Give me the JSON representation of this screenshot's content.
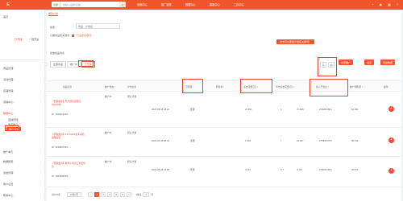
{
  "topbar": {
    "logo": "E",
    "search_select": "全部",
    "search_placeholder": "请输入品牌/店铺",
    "search_btn": "Q",
    "tabs": [
      "营销中心",
      "推广服务",
      "数据中心",
      "客服中心",
      "工具中心"
    ],
    "icons": [
      "bell-icon",
      "user-icon",
      "grid-icon",
      "help-icon"
    ]
  },
  "sidebar": {
    "items": [
      {
        "label": "首页",
        "name": "sidebar-item-home"
      },
      {
        "label": "商品管理",
        "name": "sidebar-item-goods"
      },
      {
        "label": "活动管理",
        "name": "sidebar-item-activity"
      },
      {
        "label": "店铺管理",
        "name": "sidebar-item-shop"
      },
      {
        "label": "营销中心",
        "name": "sidebar-item-marketing"
      },
      {
        "label": "数据中心",
        "name": "sidebar-item-data"
      },
      {
        "label": "直播管理",
        "name": "sidebar-item-live"
      },
      {
        "label": "商品推广",
        "name": "sidebar-item-goods-promo"
      },
      {
        "label": "推广计划",
        "name": "sidebar-item-plan"
      },
      {
        "label": "推广单元",
        "name": "sidebar-item-unit"
      },
      {
        "label": "数据报表",
        "name": "sidebar-item-report"
      },
      {
        "label": "资金管理",
        "name": "sidebar-item-finance"
      },
      {
        "label": "账户设置",
        "name": "sidebar-item-account"
      },
      {
        "label": "帮助中心",
        "name": "sidebar-item-help"
      }
    ],
    "badge_left": "已开通",
    "badge_right": "一键开启"
  },
  "main": {
    "breadcrumb": "爆款计划",
    "filter_label": "搜索：",
    "filter_value": "商品、计划名",
    "check_label": "只看未设置关键词",
    "check_label2": "已设置关键词",
    "tabs": [
      "全部商品",
      "推广中",
      "已暂停"
    ],
    "list_label": "投放商品列表",
    "callout": "点击可以添加计划名关键词！",
    "btn_add": "新增推广",
    "btn_batch": "批量",
    "btn_export": "导出数据"
  },
  "table": {
    "headers": [
      "商品信息",
      "推广状态",
      "计划信息",
      "日预算 ↕",
      "转化率 ↕",
      "点击花费(元) ↕",
      "平均点击花费(元) ↕",
      "投入产出比 ↕",
      "推广销售额 ↕",
      "操作"
    ],
    "rows": [
      {
        "title": "【安徽发货】乐乐熊新鲜果冻15g*20袋",
        "sub": "ID: 1043213432",
        "status": "推广中",
        "plan": "默认计划",
        "meta": "2021-06-18 18:24",
        "budget": "无限",
        "rate": "21.961",
        "cost": "1",
        "avg": "47.905",
        "roi": "274086.89%",
        "sales": "62.351"
      },
      {
        "title": "【安徽发货】CP-CD23 新手彩色蜡笔盒装",
        "sub": "ID: 1238907435",
        "status": "推广中",
        "plan": "默认计划",
        "meta": "2021-06-18 08:14",
        "budget": "无限",
        "rate": "1.594",
        "cost": "7",
        "avg": "23.207",
        "roi": "275995.07%",
        "sales": "50.312"
      },
      {
        "title": "【安徽发货】夏季小清新三件套组合",
        "sub": "ID: 1003930403",
        "status": "推广中",
        "plan": "默认计划",
        "meta": "2021-05-28 10:28",
        "budget": "无限",
        "rate": "4.716",
        "cost": "0.7",
        "avg": "4.716",
        "roi": "273050.60%",
        "sales": "34.871"
      }
    ],
    "plus": "+"
  },
  "pager": {
    "total": "共100条",
    "per_page": "10条/页",
    "pages": [
      "1",
      "2",
      "3",
      "4",
      "5"
    ],
    "next": ">",
    "goto": "前往",
    "page_input": "1",
    "page_unit": "页"
  },
  "colors": {
    "accent": "#f0562a",
    "red": "#e43"
  }
}
